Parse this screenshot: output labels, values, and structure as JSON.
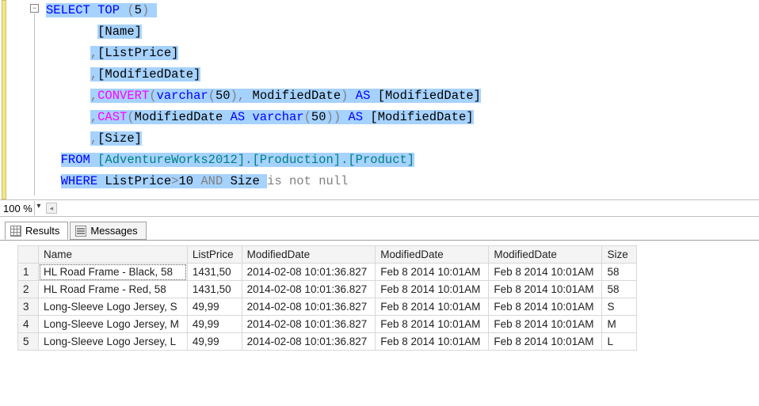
{
  "zoom": {
    "value": "100 %"
  },
  "tabs": {
    "results": "Results",
    "messages": "Messages"
  },
  "sql": {
    "l1": {
      "select": "SELECT",
      "top": "TOP",
      "open": "(",
      "topn": "5",
      "close": ")"
    },
    "l2": {
      "name": "[Name]"
    },
    "l3": {
      "comma": ",",
      "col": "[ListPrice]"
    },
    "l4": {
      "comma": ",",
      "col": "[ModifiedDate]"
    },
    "l5": {
      "comma": ",",
      "fn": "CONVERT",
      "open": "(",
      "type": "varchar",
      "o2": "(",
      "n": "50",
      "c2": ")",
      "c3": ",",
      "arg": " ModifiedDate",
      "close": ")",
      "as": "AS",
      "alias": "[ModifiedDate]"
    },
    "l6": {
      "comma": ",",
      "fn": "CAST",
      "open": "(",
      "arg": "ModifiedDate ",
      "as1": "AS",
      "type": " varchar",
      "o2": "(",
      "n": "50",
      "c2": ")",
      "close": ")",
      "as2": "AS",
      "alias": "[ModifiedDate]"
    },
    "l7": {
      "comma": ",",
      "col": "[Size]"
    },
    "l8": {
      "from": "FROM",
      "tbl": " [AdventureWorks2012].[Production].[Product]"
    },
    "l9": {
      "where": "WHERE",
      "txt1": " ListPrice",
      "gt": ">",
      "ten": "10 ",
      "and": "AND",
      "txt2": " Size ",
      "isnn": "is not null"
    }
  },
  "grid": {
    "headers": [
      "Name",
      "ListPrice",
      "ModifiedDate",
      "ModifiedDate",
      "ModifiedDate",
      "Size"
    ],
    "rows": [
      {
        "n": "1",
        "c0": "HL Road Frame - Black, 58",
        "c1": "1431,50",
        "c2": "2014-02-08 10:01:36.827",
        "c3": "Feb  8 2014 10:01AM",
        "c4": "Feb  8 2014 10:01AM",
        "c5": "58"
      },
      {
        "n": "2",
        "c0": "HL Road Frame - Red, 58",
        "c1": "1431,50",
        "c2": "2014-02-08 10:01:36.827",
        "c3": "Feb  8 2014 10:01AM",
        "c4": "Feb  8 2014 10:01AM",
        "c5": "58"
      },
      {
        "n": "3",
        "c0": "Long-Sleeve Logo Jersey, S",
        "c1": "49,99",
        "c2": "2014-02-08 10:01:36.827",
        "c3": "Feb  8 2014 10:01AM",
        "c4": "Feb  8 2014 10:01AM",
        "c5": "S"
      },
      {
        "n": "4",
        "c0": "Long-Sleeve Logo Jersey, M",
        "c1": "49,99",
        "c2": "2014-02-08 10:01:36.827",
        "c3": "Feb  8 2014 10:01AM",
        "c4": "Feb  8 2014 10:01AM",
        "c5": "M"
      },
      {
        "n": "5",
        "c0": "Long-Sleeve Logo Jersey, L",
        "c1": "49,99",
        "c2": "2014-02-08 10:01:36.827",
        "c3": "Feb  8 2014 10:01AM",
        "c4": "Feb  8 2014 10:01AM",
        "c5": "L"
      }
    ]
  }
}
